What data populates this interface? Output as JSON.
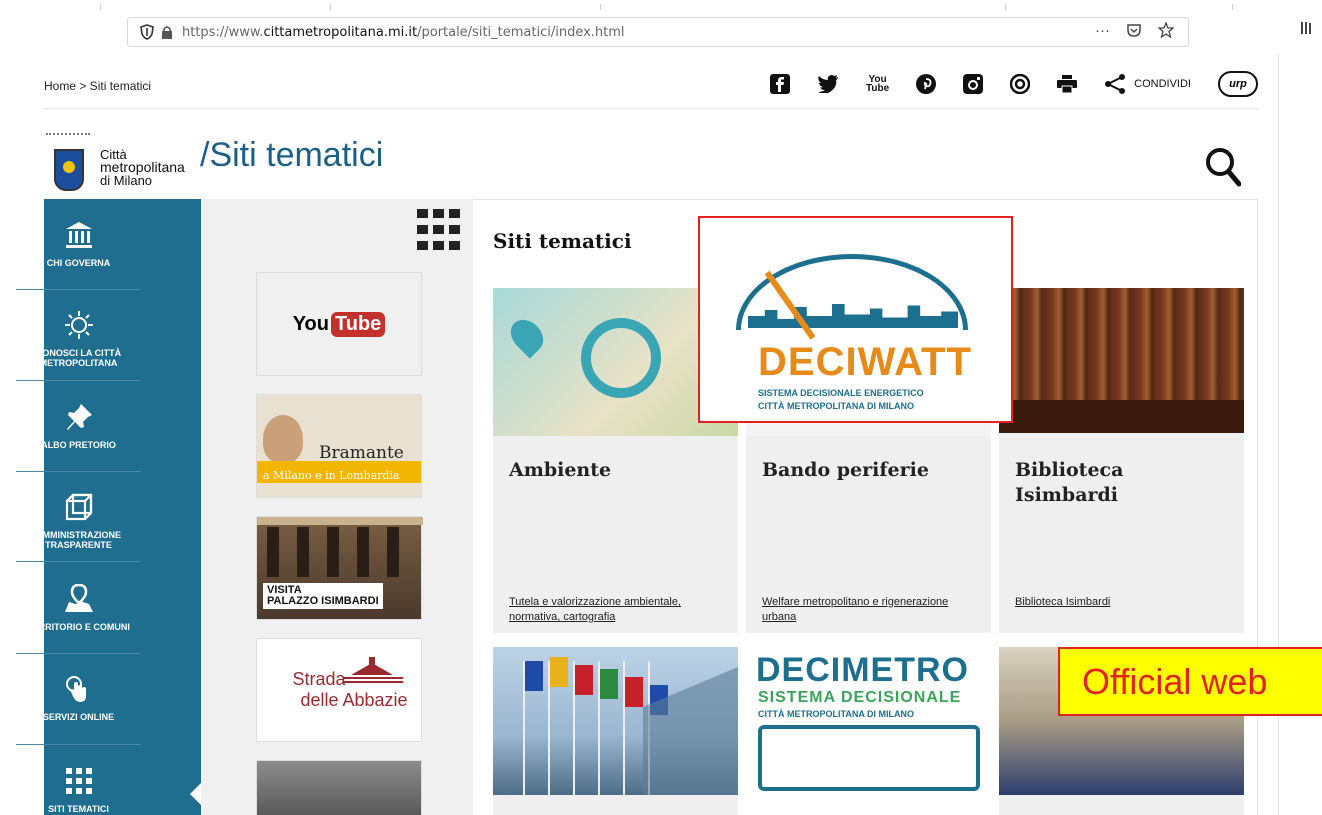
{
  "browser": {
    "url_prefix": "https://www.",
    "url_domain": "cittametropolitana.mi.it",
    "url_path": "/portale/siti_tematici/index.html",
    "more_icon": "···"
  },
  "header": {
    "breadcrumb": "Home > Siti tematici",
    "share_label": "CONDIVIDI",
    "urp_label": "urp",
    "youtube_label": "You\nTube"
  },
  "brand": {
    "line1": "Città",
    "line2": "metropolitana",
    "line3": "di Milano",
    "section_title": "/Siti tematici"
  },
  "sidebar": {
    "items": [
      {
        "label": "CHI GOVERNA",
        "icon": "bank-icon"
      },
      {
        "label": "CONOSCI LA CITTÀ METROPOLITANA",
        "icon": "sun-icon"
      },
      {
        "label": "ALBO PRETORIO",
        "icon": "pin-icon"
      },
      {
        "label": "AMMINISTRAZIONE TRASPARENTE",
        "icon": "cube-icon"
      },
      {
        "label": "TERRITORIO E COMUNI",
        "icon": "map-pin-icon"
      },
      {
        "label": "SERVIZI ONLINE",
        "icon": "touch-icon"
      },
      {
        "label": "SITI TEMATICI",
        "icon": "grid-icon"
      }
    ]
  },
  "thumbs": {
    "youtube_you": "You",
    "youtube_tube": "Tube",
    "bramante_title": "Bramante",
    "bramante_sub": "a Milano e in Lombardia",
    "visita_line1": "VISITA",
    "visita_line2": "PALAZZO ISIMBARDI",
    "abbazie_line1": "Strada",
    "abbazie_line2": "delle Abbazie"
  },
  "content": {
    "title": "Siti tematici",
    "cards": [
      {
        "title": "Ambiente",
        "link": "Tutela e valorizzazione ambientale, normativa, cartografia"
      },
      {
        "title": "Bando periferie",
        "link": "Welfare metropolitano e rigenerazione urbana"
      },
      {
        "title": "Biblioteca Isimbardi",
        "link": "Biblioteca Isimbardi"
      }
    ],
    "decimetro": {
      "line1": "DECIMETRO",
      "line2": "SISTEMA DECISIONALE",
      "line3": "CITTÀ METROPOLITANA DI MILANO"
    }
  },
  "popup": {
    "title": "DECIWATT",
    "sub1": "SISTEMA DECISIONALE ENERGETICO",
    "sub2": "CITTÀ METROPOLITANA DI MILANO"
  },
  "banner": {
    "text": "Official web"
  },
  "colors": {
    "sidebar": "#1f6e8f",
    "title": "#1a5f87",
    "deciwatt_orange": "#e68a1a",
    "highlight_red": "#e22222",
    "banner_yellow": "#ffff00"
  }
}
